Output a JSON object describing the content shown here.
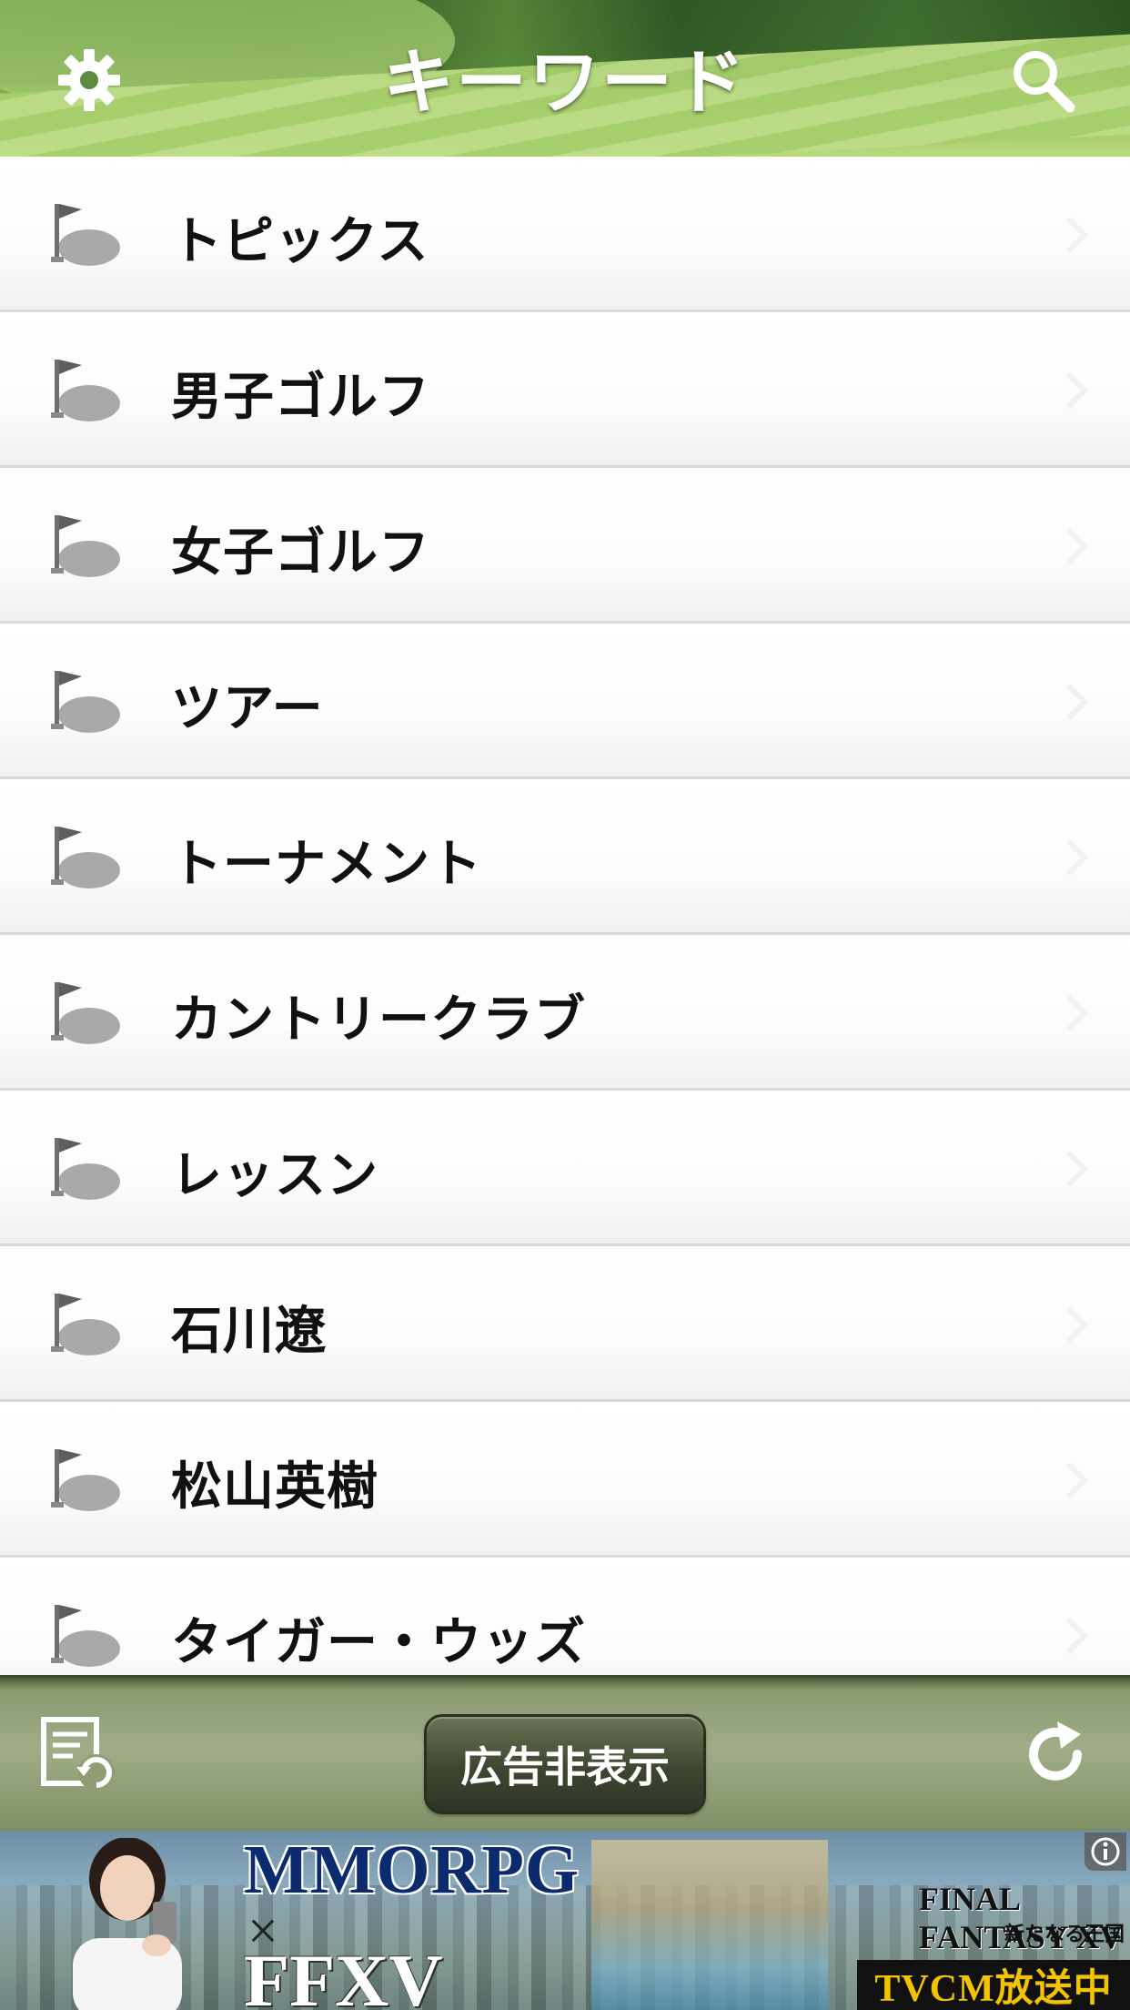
{
  "header": {
    "title": "キーワード",
    "left_icon": "gear-icon",
    "right_icon": "search-icon"
  },
  "keywords": [
    {
      "label": "トピックス"
    },
    {
      "label": "男子ゴルフ"
    },
    {
      "label": "女子ゴルフ"
    },
    {
      "label": "ツアー"
    },
    {
      "label": "トーナメント"
    },
    {
      "label": "カントリークラブ"
    },
    {
      "label": "レッスン"
    },
    {
      "label": "石川遼"
    },
    {
      "label": "松山英樹"
    },
    {
      "label": "タイガー・ウッズ"
    }
  ],
  "row_icon": "golf-flag-icon",
  "toolbar": {
    "left_icon": "archive-refresh-icon",
    "hide_ads_label": "広告非表示",
    "right_icon": "refresh-icon"
  },
  "ad": {
    "headline": "MMORPG",
    "cross": "×",
    "game": "FFXV",
    "logo": "FINAL FANTASY XV",
    "subtitle": "新たなる王国",
    "badge": "TVCM放送中",
    "info_icon": "info-icon"
  },
  "colors": {
    "toolbar": "#8f9c74",
    "title_text": "#ffffff",
    "row_text": "#111111",
    "ad_badge": "#f2c400"
  }
}
